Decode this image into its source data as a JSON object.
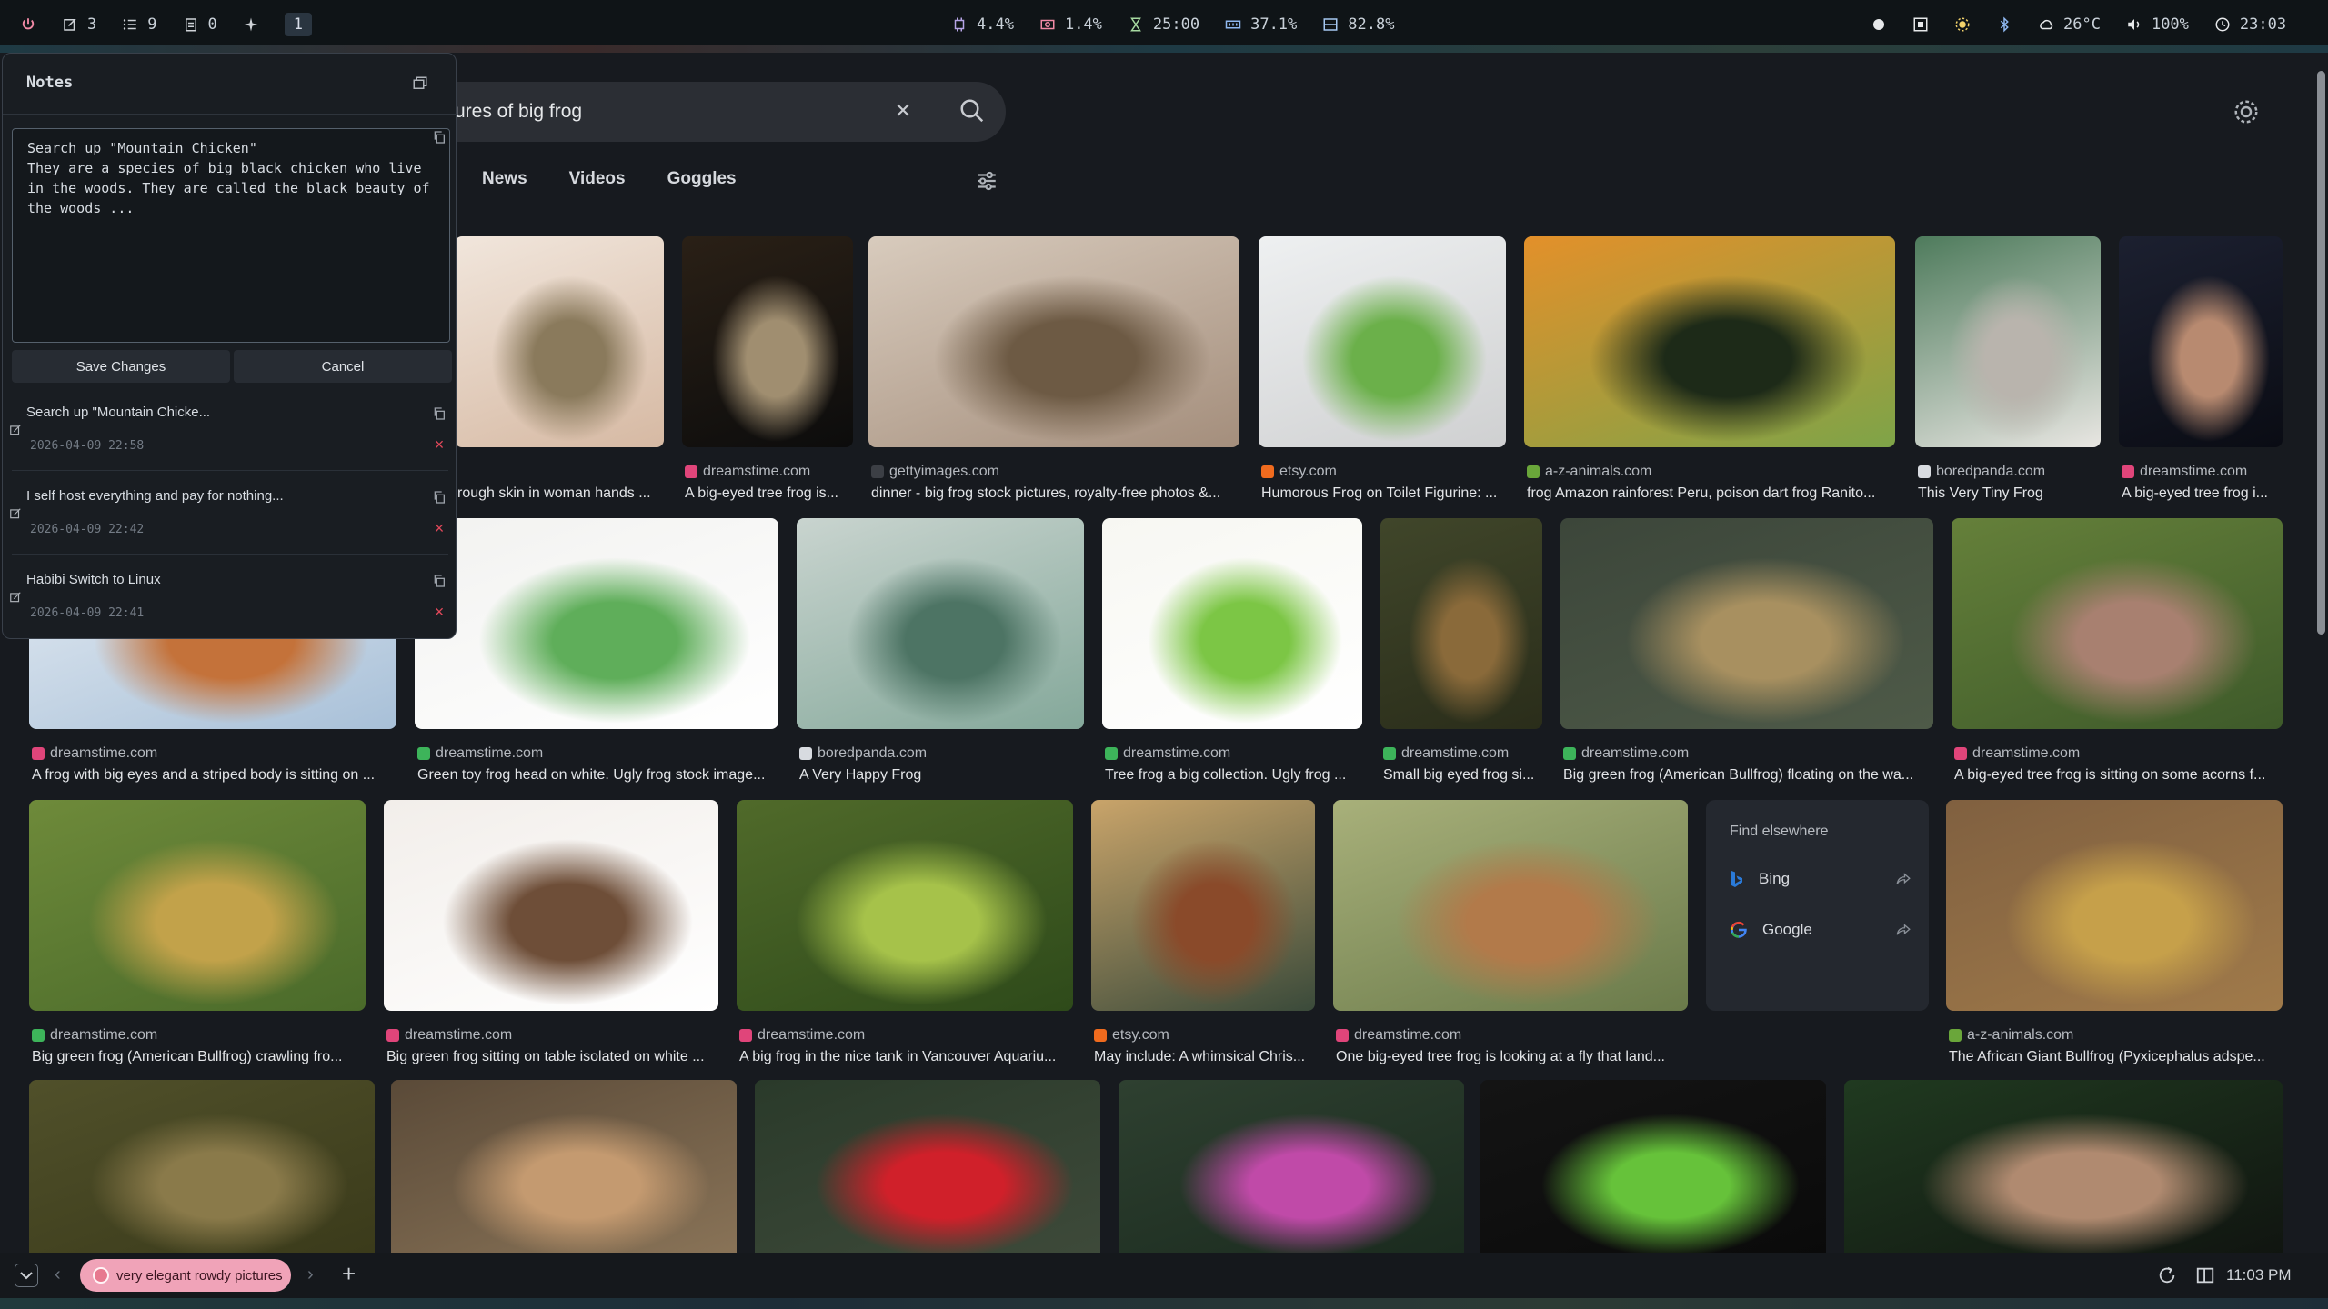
{
  "topbar": {
    "left": [
      {
        "icon": "power-icon",
        "label": ""
      },
      {
        "icon": "edit-icon",
        "label": "3"
      },
      {
        "icon": "checklist-icon",
        "label": "9"
      },
      {
        "icon": "clipboard-icon",
        "label": "0"
      },
      {
        "icon": "sparkle-icon",
        "label": ""
      },
      {
        "icon": "workspace",
        "label": "1"
      }
    ],
    "center": [
      {
        "icon": "cpu-icon",
        "label": "4.4%"
      },
      {
        "icon": "gpu-icon",
        "label": "1.4%"
      },
      {
        "icon": "hourglass-icon",
        "label": "25:00"
      },
      {
        "icon": "memory-icon",
        "label": "37.1%"
      },
      {
        "icon": "disk-icon",
        "label": "82.8%"
      }
    ],
    "right": [
      {
        "icon": "circle-icon",
        "label": ""
      },
      {
        "icon": "screenshot-icon",
        "label": ""
      },
      {
        "icon": "brightness-icon",
        "label": ""
      },
      {
        "icon": "bluetooth-icon",
        "label": ""
      },
      {
        "icon": "weather-icon",
        "label": "26°C"
      },
      {
        "icon": "volume-icon",
        "label": "100%"
      },
      {
        "icon": "clock-icon",
        "label": "23:03"
      }
    ]
  },
  "search": {
    "query": "ures of big frog"
  },
  "tabs": [
    "News",
    "Videos",
    "Goggles"
  ],
  "results": [
    {
      "source": "",
      "caption": "rough skin in woman hands ...",
      "fav": "#2f3640",
      "colors": [
        "#d6b9a3",
        "#8a7a5c",
        "#f1e6dc"
      ]
    },
    {
      "source": "dreamstime.com",
      "caption": "A big-eyed tree frog is...",
      "fav": "#e0457a",
      "colors": [
        "#0c0c0c",
        "#a08e70",
        "#2a2016"
      ]
    },
    {
      "source": "gettyimages.com",
      "caption": "dinner - big frog stock pictures, royalty-free photos &...",
      "fav": "#3c3f45",
      "colors": [
        "#a48e7c",
        "#6d5a44",
        "#d8cbbd"
      ]
    },
    {
      "source": "etsy.com",
      "caption": "Humorous Frog on Toilet Figurine: ...",
      "fav": "#f06b1e",
      "colors": [
        "#cfd0d1",
        "#6bb04a",
        "#eef0f1"
      ]
    },
    {
      "source": "a-z-animals.com",
      "caption": "frog Amazon rainforest Peru, poison dart frog Ranito...",
      "fav": "#6aa63a",
      "colors": [
        "#7ea448",
        "#1d2a18",
        "#e3902a"
      ]
    },
    {
      "source": "boredpanda.com",
      "caption": "This Very Tiny Frog",
      "fav": "#d8dbe0",
      "colors": [
        "#e8e6e2",
        "#b9b4ad",
        "#4e7b5c"
      ]
    },
    {
      "source": "dreamstime.com",
      "caption": "A big-eyed tree frog i...",
      "fav": "#e0457a",
      "colors": [
        "#0a0c14",
        "#b88a70",
        "#1c2030"
      ]
    },
    {
      "source": "dreamstime.com",
      "caption": "A frog with big eyes and a striped body is sitting on ...",
      "fav": "#e0457a",
      "colors": [
        "#a8c0d8",
        "#c4723a",
        "#e8eef4"
      ]
    },
    {
      "source": "dreamstime.com",
      "caption": "Green toy frog head on white. Ugly frog stock image...",
      "fav": "#3db45a",
      "colors": [
        "#ffffff",
        "#5fae5a",
        "#f2f2f0"
      ]
    },
    {
      "source": "boredpanda.com",
      "caption": "A Very Happy Frog",
      "fav": "#d8dbe0",
      "colors": [
        "#84a89a",
        "#4d7464",
        "#c9d4cf"
      ]
    },
    {
      "source": "dreamstime.com",
      "caption": "Tree frog a big collection. Ugly frog ...",
      "fav": "#3db45a",
      "colors": [
        "#ffffff",
        "#7cc645",
        "#f7f7f2"
      ]
    },
    {
      "source": "dreamstime.com",
      "caption": "Small big eyed frog si...",
      "fav": "#3db45a",
      "colors": [
        "#2a2d1a",
        "#8a6a3a",
        "#40462a"
      ]
    },
    {
      "source": "dreamstime.com",
      "caption": "Big green frog (American Bullfrog) floating on the wa...",
      "fav": "#3db45a",
      "colors": [
        "#4e5a48",
        "#a89060",
        "#3c463a"
      ]
    },
    {
      "source": "dreamstime.com",
      "caption": "A big-eyed tree frog is sitting on some acorns f...",
      "fav": "#e0457a",
      "colors": [
        "#3e5a2a",
        "#a88070",
        "#65803a"
      ]
    },
    {
      "source": "dreamstime.com",
      "caption": "Big green frog (American Bullfrog) crawling fro...",
      "fav": "#3db45a",
      "colors": [
        "#4a6a2a",
        "#c2a24a",
        "#6e8a3a"
      ]
    },
    {
      "source": "dreamstime.com",
      "caption": "Big green frog sitting on table isolated on white ...",
      "fav": "#e0457a",
      "colors": [
        "#ffffff",
        "#6e4e38",
        "#f2eeea"
      ]
    },
    {
      "source": "dreamstime.com",
      "caption": "A big frog in the nice tank in Vancouver Aquariu...",
      "fav": "#e0457a",
      "colors": [
        "#2e4a1a",
        "#a6c24a",
        "#506a2a"
      ]
    },
    {
      "source": "etsy.com",
      "caption": "May include: A whimsical Chris...",
      "fav": "#f06b1e",
      "colors": [
        "#3a4a3a",
        "#8a4a2a",
        "#c9a46a"
      ]
    },
    {
      "source": "dreamstime.com",
      "caption": "One big-eyed tree frog is looking at a fly that land...",
      "fav": "#e0457a",
      "colors": [
        "#6a7a4a",
        "#b27a4a",
        "#a8b07a"
      ]
    },
    {
      "source": "a-z-animals.com",
      "caption": "The African Giant Bullfrog (Pyxicephalus adspe...",
      "fav": "#6aa63a",
      "colors": [
        "#a07a4a",
        "#c6a04a",
        "#806040"
      ]
    },
    {
      "source": "",
      "caption": "",
      "fav": "",
      "colors": [
        "#3a3a1a",
        "#8a7a4a",
        "#50502a"
      ]
    },
    {
      "source": "",
      "caption": "",
      "fav": "",
      "colors": [
        "#8a7458",
        "#c49a70",
        "#5a4a38"
      ]
    },
    {
      "source": "",
      "caption": "",
      "fav": "",
      "colors": [
        "#3e4a3a",
        "#d0202a",
        "#2a3a2a"
      ]
    },
    {
      "source": "",
      "caption": "",
      "fav": "",
      "colors": [
        "#1a2a1e",
        "#c04aa8",
        "#2e4030"
      ]
    },
    {
      "source": "",
      "caption": "",
      "fav": "",
      "colors": [
        "#0a0a0a",
        "#66c23a",
        "#141414"
      ]
    },
    {
      "source": "",
      "caption": "",
      "fav": "",
      "colors": [
        "#101410",
        "#b08a70",
        "#203a20"
      ]
    }
  ],
  "find_elsewhere": {
    "heading": "Find elsewhere",
    "engines": [
      {
        "name": "Bing",
        "icon": "bing-icon",
        "color": "#2a7ad8"
      },
      {
        "name": "Google",
        "icon": "google-icon",
        "color": "#e94235"
      }
    ]
  },
  "notes": {
    "title": "Notes",
    "current_text": "Search up \"Mountain Chicken\"\nThey are a species of big black chicken who live in the woods. They are called the black beauty of the woods ... ",
    "save_label": "Save Changes",
    "cancel_label": "Cancel",
    "items": [
      {
        "title": "Search up \"Mountain Chicke...",
        "date": "2026-04-09 22:58"
      },
      {
        "title": "I self host everything and pay for nothing...",
        "date": "2026-04-09 22:42"
      },
      {
        "title": "Habibi Switch to Linux",
        "date": "2026-04-09 22:41"
      }
    ]
  },
  "bottombar": {
    "tab_title": "very elegant rowdy pictures",
    "clock": "11:03 PM"
  }
}
